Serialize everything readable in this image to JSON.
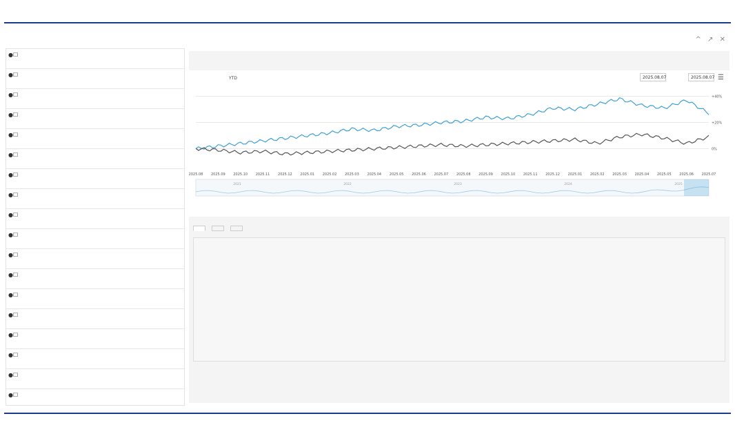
{
  "caption": "",
  "window": {
    "title": "",
    "controls": [
      "^",
      "↗",
      "✕"
    ]
  },
  "sidebar": {
    "items": [
      {
        "name": "",
        "detail": "",
        "action": ""
      },
      {
        "name": "",
        "detail": "",
        "action": ""
      },
      {
        "name": "",
        "detail": "",
        "action": ""
      },
      {
        "name": "",
        "detail": "",
        "action": "",
        "active": true
      },
      {
        "name": "",
        "detail": "",
        "action": ""
      },
      {
        "name": "",
        "detail": "",
        "action": ""
      },
      {
        "name": "",
        "detail": "",
        "action": ""
      },
      {
        "name": "",
        "detail": "",
        "action": ""
      },
      {
        "name": "",
        "detail": "",
        "action": ""
      },
      {
        "name": "",
        "detail": "",
        "action": ""
      },
      {
        "name": "",
        "detail": "",
        "action": ""
      },
      {
        "name": "",
        "detail": "",
        "action": ""
      },
      {
        "name": "",
        "detail": "",
        "action": ""
      },
      {
        "name": "",
        "detail": "",
        "action": ""
      },
      {
        "name": "",
        "detail": "",
        "action": ""
      },
      {
        "name": "",
        "detail": "",
        "action": ""
      },
      {
        "name": "",
        "detail": "",
        "action": ""
      },
      {
        "name": "",
        "detail": "",
        "action": ""
      }
    ]
  },
  "main": {
    "history_title": "",
    "range_buttons": [
      {
        "label": "",
        "selected": false
      },
      {
        "label": "",
        "selected": false
      },
      {
        "label": "",
        "selected": false
      },
      {
        "label": "",
        "selected": false
      },
      {
        "label": "YTD",
        "selected": false
      },
      {
        "label": "",
        "selected": false
      },
      {
        "label": "",
        "selected": true
      }
    ],
    "start_label": "",
    "start_value": "2025.08.07",
    "end_label": "",
    "end_value": "2025.08.07",
    "tabs": [
      {
        "label": "",
        "selected": true
      },
      {
        "label": "",
        "selected": false
      },
      {
        "label": "",
        "selected": false
      }
    ],
    "content_lines": [
      {
        "text": "",
        "heading": true
      },
      {
        "text": "",
        "heading": false
      },
      {
        "text": "",
        "heading": false
      },
      {
        "text": "",
        "heading": false
      },
      {
        "text": "",
        "heading": false
      },
      {
        "text": "",
        "heading": false
      },
      {
        "text": "",
        "heading": false
      },
      {
        "text": "",
        "heading": false
      },
      {
        "text": "",
        "heading": false
      },
      {
        "text": "",
        "heading": false
      },
      {
        "text": "",
        "heading": false
      },
      {
        "text": "",
        "heading": false
      },
      {
        "text": "",
        "heading": false
      },
      {
        "text": "",
        "heading": false
      },
      {
        "text": "",
        "heading": false
      },
      {
        "text": "",
        "heading": false
      }
    ]
  },
  "colors": {
    "strategy": "#3ca0d8",
    "benchmark": "#555555",
    "active": "#d9000d"
  },
  "chart_data": {
    "type": "line",
    "x": [
      "2025.08",
      "2025.09",
      "2025.10",
      "2025.11",
      "2025.12",
      "2025.01",
      "2025.02",
      "2025.03",
      "2025.04",
      "2025.05",
      "2025.06",
      "2025.07",
      "2025.08",
      "2025.09",
      "2025.10",
      "2025.11",
      "2025.12",
      "2025.01",
      "2025.02",
      "2025.03",
      "2025.04",
      "2025.05",
      "2025.06",
      "2025.07"
    ],
    "series": [
      {
        "values": [
          0,
          2,
          4,
          6,
          8,
          10,
          12,
          15,
          14,
          17,
          18,
          20,
          21,
          24,
          23,
          26,
          31,
          30,
          34,
          38,
          33,
          31,
          37,
          27
        ]
      },
      {
        "values": [
          0,
          -1,
          -3,
          -2,
          -4,
          -3,
          -2,
          -1,
          0,
          1,
          2,
          3,
          2,
          3,
          4,
          5,
          6,
          7,
          4,
          9,
          11,
          8,
          4,
          9
        ]
      }
    ],
    "y_ticks": [
      "+40%",
      "+20%",
      "0%"
    ],
    "ylim": [
      -15,
      45
    ],
    "nav_labels": [
      "2021",
      "2022",
      "2023",
      "2024",
      "2025"
    ]
  }
}
